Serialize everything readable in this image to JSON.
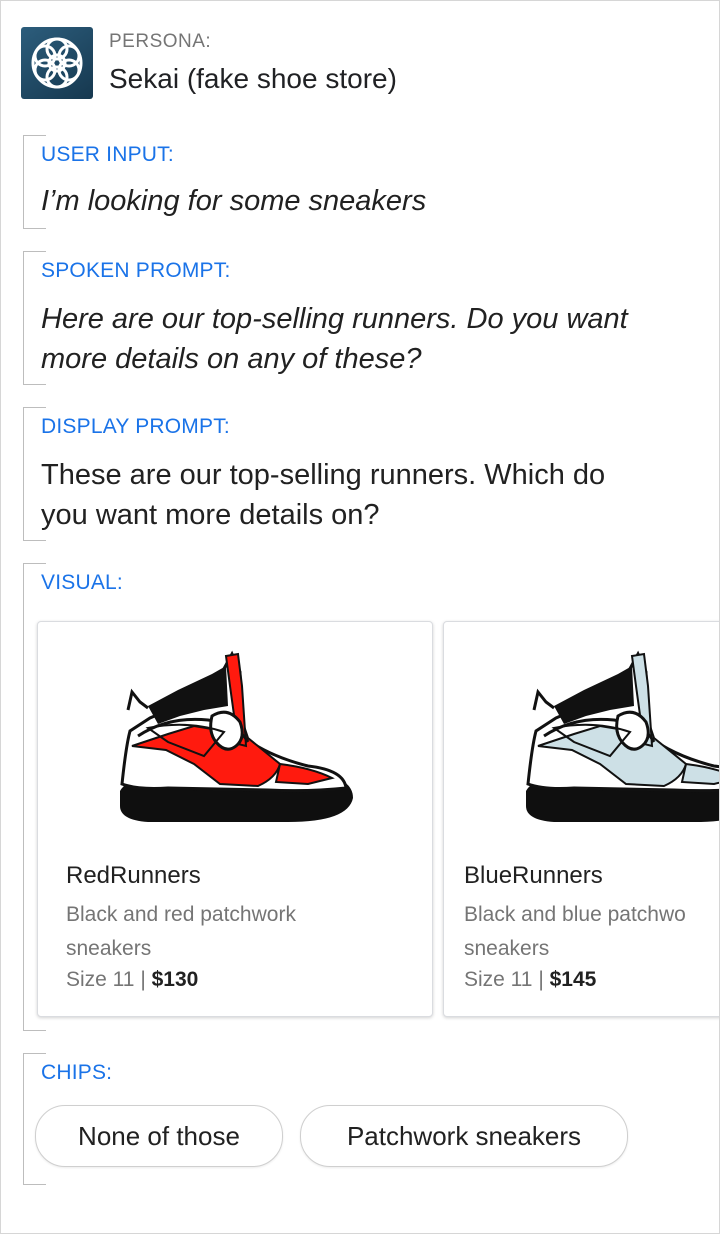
{
  "persona": {
    "label": "PERSONA:",
    "name": "Sekai (fake shoe store)",
    "logo_icon": "flower-logo-icon"
  },
  "user_input": {
    "label": "USER INPUT:",
    "text": "I’m looking for some sneakers"
  },
  "spoken_prompt": {
    "label": "SPOKEN PROMPT:",
    "line1": "Here are our top-selling runners. Do you want",
    "line2": "more details on any of these?"
  },
  "display_prompt": {
    "label": "DISPLAY PROMPT:",
    "line1": "These are our top-selling runners. Which do",
    "line2": "you want more details on?"
  },
  "visual": {
    "label": "VISUAL:",
    "cards": [
      {
        "title": "RedRunners",
        "desc_line1": "Black and red patchwork",
        "desc_line2": "sneakers",
        "size": "Size 11 | ",
        "price": "$130",
        "image_icon": "red-sneaker-icon",
        "accent": "#ff1a0e"
      },
      {
        "title": "BlueRunners",
        "desc_line1": "Black and blue patchwo",
        "desc_line2": "sneakers",
        "size": "Size 11 | ",
        "price": "$145",
        "image_icon": "blue-sneaker-icon",
        "accent": "#cde0e6"
      }
    ]
  },
  "chips": {
    "label": "CHIPS:",
    "items": [
      "None of those",
      "Patchwork sneakers"
    ]
  },
  "colors": {
    "label_blue": "#1a73e8",
    "border": "#d6d6d6"
  }
}
